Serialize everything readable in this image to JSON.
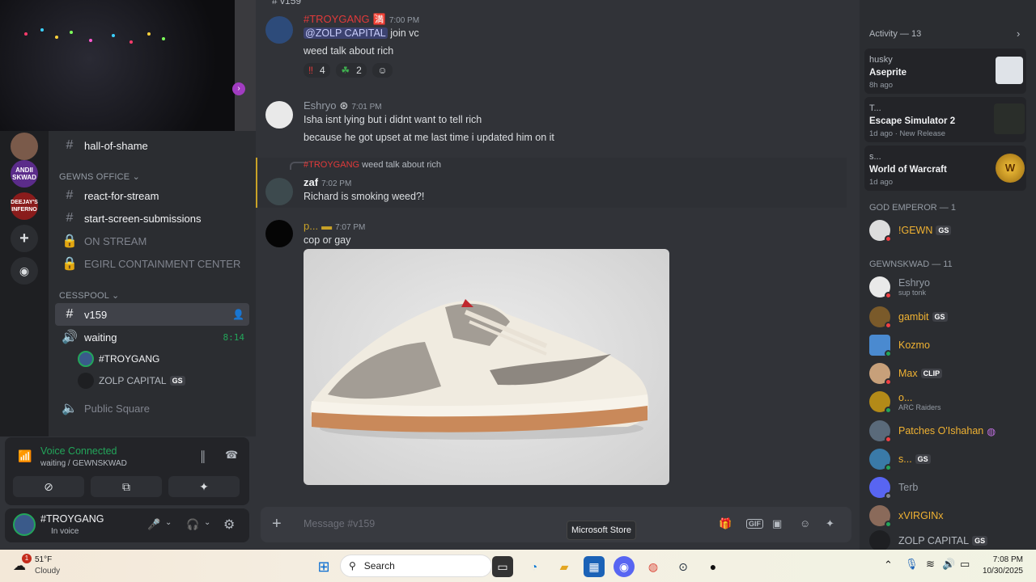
{
  "webcam": {
    "label": "stream webcam"
  },
  "channels": {
    "items_top": [
      {
        "label": "hall-of-shame"
      }
    ],
    "category1": "GEWNS OFFICE",
    "office": [
      {
        "label": "react-for-stream"
      },
      {
        "label": "start-screen-submissions"
      },
      {
        "label": "ON STREAM"
      },
      {
        "label": "EGIRL CONTAINMENT CENTER"
      }
    ],
    "category2": "CESSPOOL",
    "cesspool_text": "v159",
    "voice_channel": "waiting",
    "voice_time": "8:14",
    "voice_users": [
      {
        "name": "#TROYGANG"
      },
      {
        "name": "ZOLP CAPITAL",
        "badge": "GS"
      }
    ],
    "public": "Public Square"
  },
  "voice_panel": {
    "status": "Voice Connected",
    "sub": "waiting / GEWNSKWAD"
  },
  "user_panel": {
    "name": "#TROYGANG",
    "status": "In voice"
  },
  "servers": {
    "s1": "ANDII SKWAD",
    "s2": "DEEJAY'S INFERNO"
  },
  "chat": {
    "channel": "v159",
    "messages": [
      {
        "user": "#TROYGANG",
        "time": "7:00 PM",
        "mention": "@ZOLP CAPITAL",
        "line1": "join vc",
        "line2": "weed talk about rich",
        "r1": "4",
        "r2": "2"
      },
      {
        "user": "Eshryo",
        "time": "7:01 PM",
        "line1": "Isha isnt lying but i didnt want to tell rich",
        "line2": "because he got upset at me last time i updated him on it"
      },
      {
        "reply_user": "#TROYGANG",
        "reply_text": "weed talk about rich",
        "user": "zaf",
        "time": "7:02 PM",
        "line1": "Richard is smoking weed?!"
      },
      {
        "user": "p...",
        "time": "7:07 PM",
        "line1": "cop or gay"
      }
    ],
    "placeholder": "Message #v159"
  },
  "members": {
    "activity_title": "Activity — 13",
    "activities": [
      {
        "user": "husky",
        "title": "Aseprite",
        "sub": "8h ago"
      },
      {
        "user": "T...",
        "title": "Escape Simulator 2",
        "sub": "1d ago",
        "extra": "New Release"
      },
      {
        "user": "s...",
        "title": "World of Warcraft",
        "sub": "1d ago"
      }
    ],
    "group1": "GOD EMPEROR — 1",
    "group1_members": [
      {
        "name": "!GEWN",
        "badge": "GS"
      }
    ],
    "group2": "GEWNSKWAD — 11",
    "group2_members": [
      {
        "name": "Eshryo",
        "sub": "sup tonk"
      },
      {
        "name": "gambit",
        "badge": "GS"
      },
      {
        "name": "Kozmo"
      },
      {
        "name": "Max",
        "badge": "CLIP"
      },
      {
        "name": "o...",
        "sub": "ARC Raiders"
      },
      {
        "name": "Patches O'Ishahan"
      },
      {
        "name": "s...",
        "badge": "GS"
      },
      {
        "name": "Terb"
      },
      {
        "name": "xVIRGINx"
      },
      {
        "name": "ZOLP CAPITAL",
        "badge": "GS"
      }
    ]
  },
  "tooltip": "Microsoft Store",
  "taskbar": {
    "temp": "51°F",
    "weather": "Cloudy",
    "search": "Search",
    "time": "7:08 PM",
    "date": "10/30/2025",
    "badge": "1"
  }
}
